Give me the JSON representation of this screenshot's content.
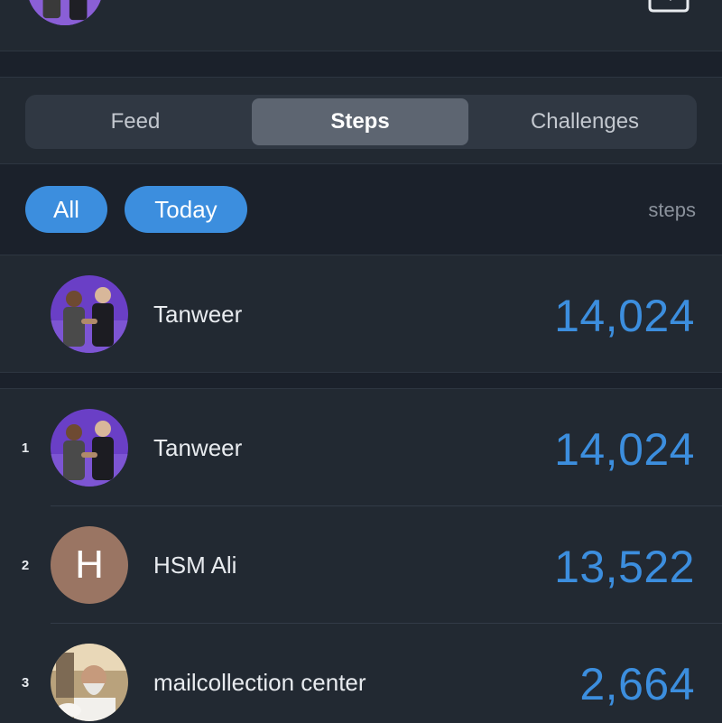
{
  "tabs": [
    {
      "label": "Feed"
    },
    {
      "label": "Steps"
    },
    {
      "label": "Challenges"
    }
  ],
  "filters": {
    "all_label": "All",
    "today_label": "Today",
    "unit_label": "steps"
  },
  "me": {
    "name": "Tanweer",
    "steps": "14,024"
  },
  "leaderboard": [
    {
      "rank": "1",
      "name": "Tanweer",
      "steps": "14,024"
    },
    {
      "rank": "2",
      "name": "HSM Ali",
      "steps": "13,522",
      "initial": "H"
    },
    {
      "rank": "3",
      "name": "mailcollection center",
      "steps": "2,664"
    }
  ],
  "colors": {
    "accent": "#3c8ede",
    "background": "#1b212b",
    "surface": "#222932"
  }
}
